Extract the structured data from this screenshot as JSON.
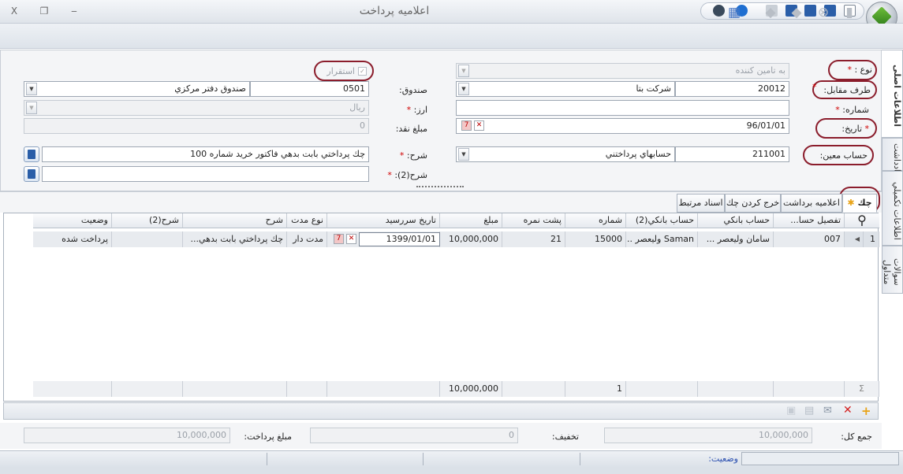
{
  "window": {
    "title": "اعلاميه پرداخت",
    "close_glyph": "X",
    "restore_glyph": "❐",
    "minimize_glyph": "‒"
  },
  "form": {
    "type_label": "نوع :",
    "type_value": "به تامين كننده",
    "confirm_label": "استقرار",
    "counterparty_label": "طرف مقابل:",
    "counterparty_code": "20012",
    "counterparty_name": "شركت بتا",
    "fund_label": "صندوق:",
    "fund_code": "0501",
    "fund_name": "صندوق دفتر مركزي",
    "number_label": "شماره:",
    "currency_label": "ارز:",
    "currency_value": "ريال",
    "date_label": "تاريخ:",
    "date_value": "96/01/01",
    "cash_label": "مبلغ نقد:",
    "cash_value": "0",
    "account_label": "حساب معين:",
    "account_code": "211001",
    "account_name": "حسابهاي پرداختني",
    "desc_label": "شرح:",
    "desc_value": "چك پرداختي بابت بدهي فاكتور خريد شماره 100",
    "desc2_label": "شرح(2):",
    "desc2_value": ""
  },
  "side_tabs": [
    "اطلاعات اصلی",
    "يادداشت",
    "اطلاعات تكميلي",
    "سوالات متداول"
  ],
  "detail_tabs": [
    "چك",
    "اعلاميه برداشت",
    "خرج كردن چك",
    "اسناد مرتبط"
  ],
  "grid": {
    "columns": [
      "تفصيل حسا...",
      "حساب بانكي",
      "حساب بانكي(2)",
      "شماره",
      "پشت نمره",
      "مبلغ",
      "تاريخ سررسيد",
      "نوع مدت",
      "شرح",
      "شرح(2)",
      "وضعيت"
    ],
    "rows": [
      {
        "row_no": "1",
        "detail": "007",
        "bank_account": "سامان وليعصر ...",
        "bank_account2": "Saman وليعصر ...",
        "number": "15000",
        "serial": "21",
        "amount": "10,000,000",
        "due_date": "1399/01/01",
        "term_type": "مدت دار",
        "desc": "چك پرداختي بابت بدهي...",
        "desc2": "",
        "status": "پرداخت شده"
      }
    ],
    "footer": {
      "sigma": "Σ",
      "count": "1",
      "amount_total": "10,000,000"
    }
  },
  "totals": {
    "total_label": "جمع كل:",
    "total_value": "10,000,000",
    "discount_label": "تخفيف:",
    "discount_value": "0",
    "payment_label": "مبلغ پرداخت:",
    "payment_value": "10,000,000"
  },
  "status": {
    "label": "وضعيت:"
  },
  "colors": {
    "highlight_ring": "#8b1d2c",
    "required": "#d00000",
    "status_text": "#2a4fb0"
  }
}
